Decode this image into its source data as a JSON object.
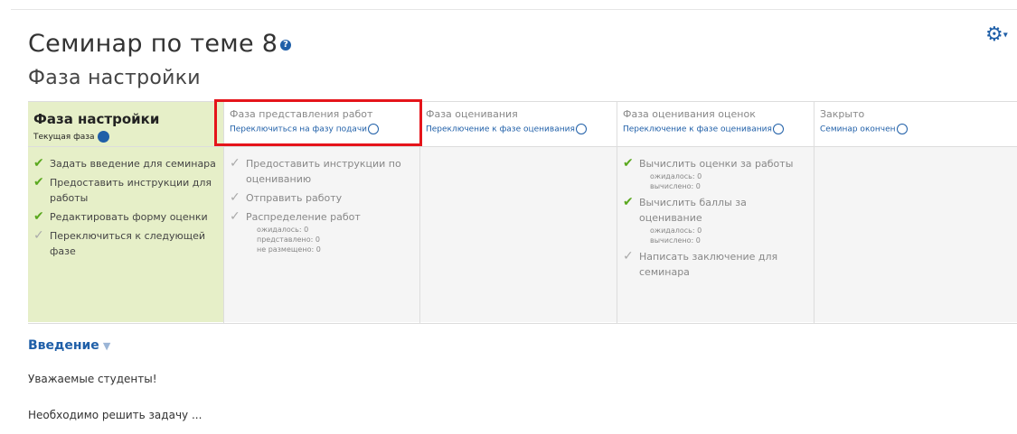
{
  "page": {
    "title": "Семинар по теме 8",
    "help_icon": "question-icon",
    "subtitle": "Фаза настройки",
    "gear_icon": "gear-icon"
  },
  "planner": {
    "phases": [
      {
        "name": "Фаза настройки",
        "status": "Текущая фаза",
        "active": true,
        "tasks": [
          {
            "label": "Задать введение для семинара",
            "done": true
          },
          {
            "label": "Предоставить инструкции для работы",
            "done": true
          },
          {
            "label": "Редактировать форму оценки",
            "done": true
          },
          {
            "label": "Переключиться к следующей фазе",
            "done": false
          }
        ]
      },
      {
        "name": "Фаза представления работ",
        "switch": "Переключиться на фазу подачи",
        "tasks": [
          {
            "label": "Предоставить инструкции по оцениванию",
            "done": false
          },
          {
            "label": "Отправить работу",
            "done": false
          },
          {
            "label": "Распределение работ",
            "done": false,
            "details": [
              "ожидалось: 0",
              "представлено: 0",
              "не размещено: 0"
            ]
          }
        ]
      },
      {
        "name": "Фаза оценивания",
        "switch": "Переключение к фазе оценивания",
        "tasks": []
      },
      {
        "name": "Фаза оценивания оценок",
        "switch": "Переключение к фазе оценивания",
        "tasks": [
          {
            "label": "Вычислить оценки за работы",
            "done": true,
            "details": [
              "ожидалось: 0",
              "вычислено: 0"
            ]
          },
          {
            "label": "Вычислить баллы за оценивание",
            "done": true,
            "details": [
              "ожидалось: 0",
              "вычислено: 0"
            ]
          },
          {
            "label": "Написать заключение для семинара",
            "done": false
          }
        ]
      },
      {
        "name": "Закрыто",
        "switch": "Семинар окончен",
        "tasks": []
      }
    ]
  },
  "intro": {
    "heading": "Введение",
    "paragraphs": [
      "Уважаемые студенты!",
      "Необходимо решить задачу ..."
    ]
  },
  "colors": {
    "accent": "#1f5fa8",
    "active_phase_bg": "#e6efc8",
    "done_check": "#5aa81e",
    "highlight_box": "#e5141a"
  }
}
